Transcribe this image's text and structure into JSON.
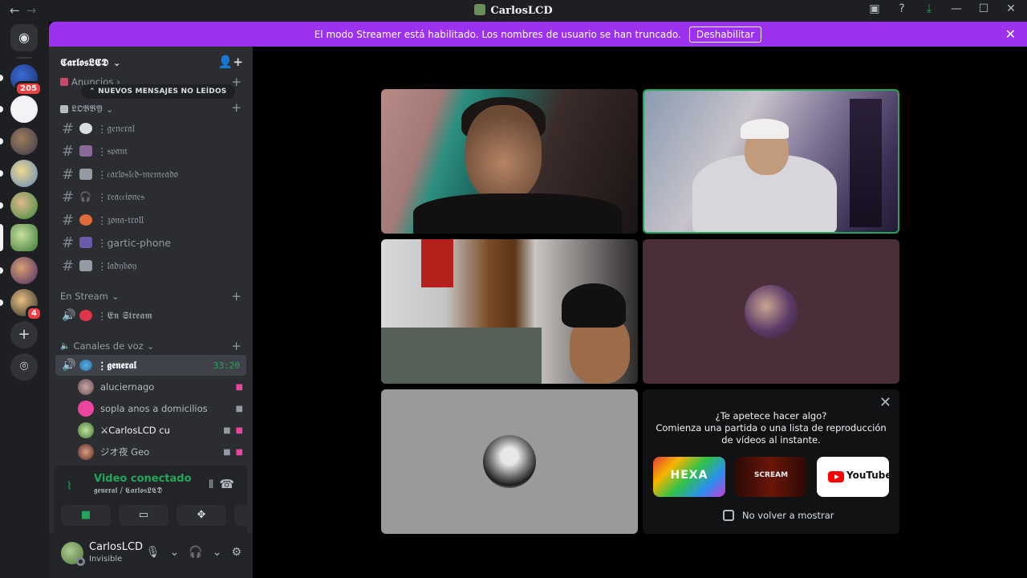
{
  "window": {
    "title": "CarlosLCD",
    "back_icon": "←",
    "forward_icon": "→",
    "inbox_icon": "▣",
    "help_icon": "?",
    "download_icon": "⤓",
    "minimize_icon": "—",
    "maximize_icon": "☐",
    "close_icon": "✕"
  },
  "banner": {
    "text": "El modo Streamer está habilitado. Los nombres de usuario se han truncado.",
    "button": "Deshabilitar",
    "close_icon": "✕",
    "color": "#9c31ee"
  },
  "rail": {
    "badges": {
      "first": "205",
      "last": "4"
    },
    "add_icon": "+",
    "explore_icon": "⌾"
  },
  "guild": {
    "name": "𝕮𝖆𝖗𝖑𝖔𝖘𝕷𝕮𝕯",
    "chevron": "⌄",
    "invite_icon": "👤+"
  },
  "new_messages": "NUEVOS MENSAJES NO LEÍDOS",
  "categories": {
    "announcements": "Anuncios",
    "lobby": "𝕷𝕺𝕭𝕭𝖄",
    "stream": "En Stream",
    "voice": "Canales de voz"
  },
  "channels": [
    {
      "name": "𝔤𝔢𝔫𝔢𝔯𝔞𝔩"
    },
    {
      "name": "𝔰𝔭𝔞𝔪"
    },
    {
      "name": "𝔠𝔞𝔯𝔩𝔬𝔰𝔩𝔠𝔡-𝔪𝔢𝔪𝔢𝔞𝔡𝔬"
    },
    {
      "name": "𝔯𝔢𝔞𝔠𝔠𝔦𝔬𝔫𝔢𝔰"
    },
    {
      "name": "𝔷𝔬𝔫𝔞-𝔱𝔯𝔬𝔩𝔩"
    },
    {
      "name": "gartic-phone"
    },
    {
      "name": "𝔩𝔞𝔡𝔶𝔟𝔬𝔶"
    }
  ],
  "stream_channel": "𝕰𝖓 𝕾𝖙𝖗𝖊𝖆𝖒",
  "voice_channel": {
    "name": "𝖌𝖊𝖓𝖊𝖗𝖆𝖑",
    "time": "33:20"
  },
  "voice_users": [
    {
      "name": "aluciernago"
    },
    {
      "name": "sopla anos a domicilios"
    },
    {
      "name": "⚔CarlosLCD cu"
    },
    {
      "name": "ジオ夜 Geo"
    }
  ],
  "voice_panel": {
    "title": "Video conectado",
    "subtitle": "𝖌𝖊𝖓𝖊𝖗𝖆𝖑 / 𝕮𝖆𝖗𝖑𝖔𝖘𝕷𝕮𝕯",
    "wave_icon": "⫴",
    "hangup_icon": "☎",
    "signal_icon": "⌇"
  },
  "user": {
    "name": "CarlosLCD",
    "status": "Invisible",
    "mic_icon": "🎙",
    "headset_icon": "🎧",
    "settings_icon": "⚙"
  },
  "activity": {
    "question": "¿Te apetece hacer algo?",
    "line1": "Comienza una partida o una lista de reproducción",
    "line2": "de vídeos al instante.",
    "cards": [
      "HEXA",
      "SCREAM",
      "YouTube"
    ],
    "checkbox": "No volver a mostrar",
    "close_icon": "✕"
  },
  "colors": {
    "accent_green": "#23a55a",
    "badge_red": "#f23f43",
    "sidebar": "#2b2d31",
    "rail": "#1e1f22"
  }
}
